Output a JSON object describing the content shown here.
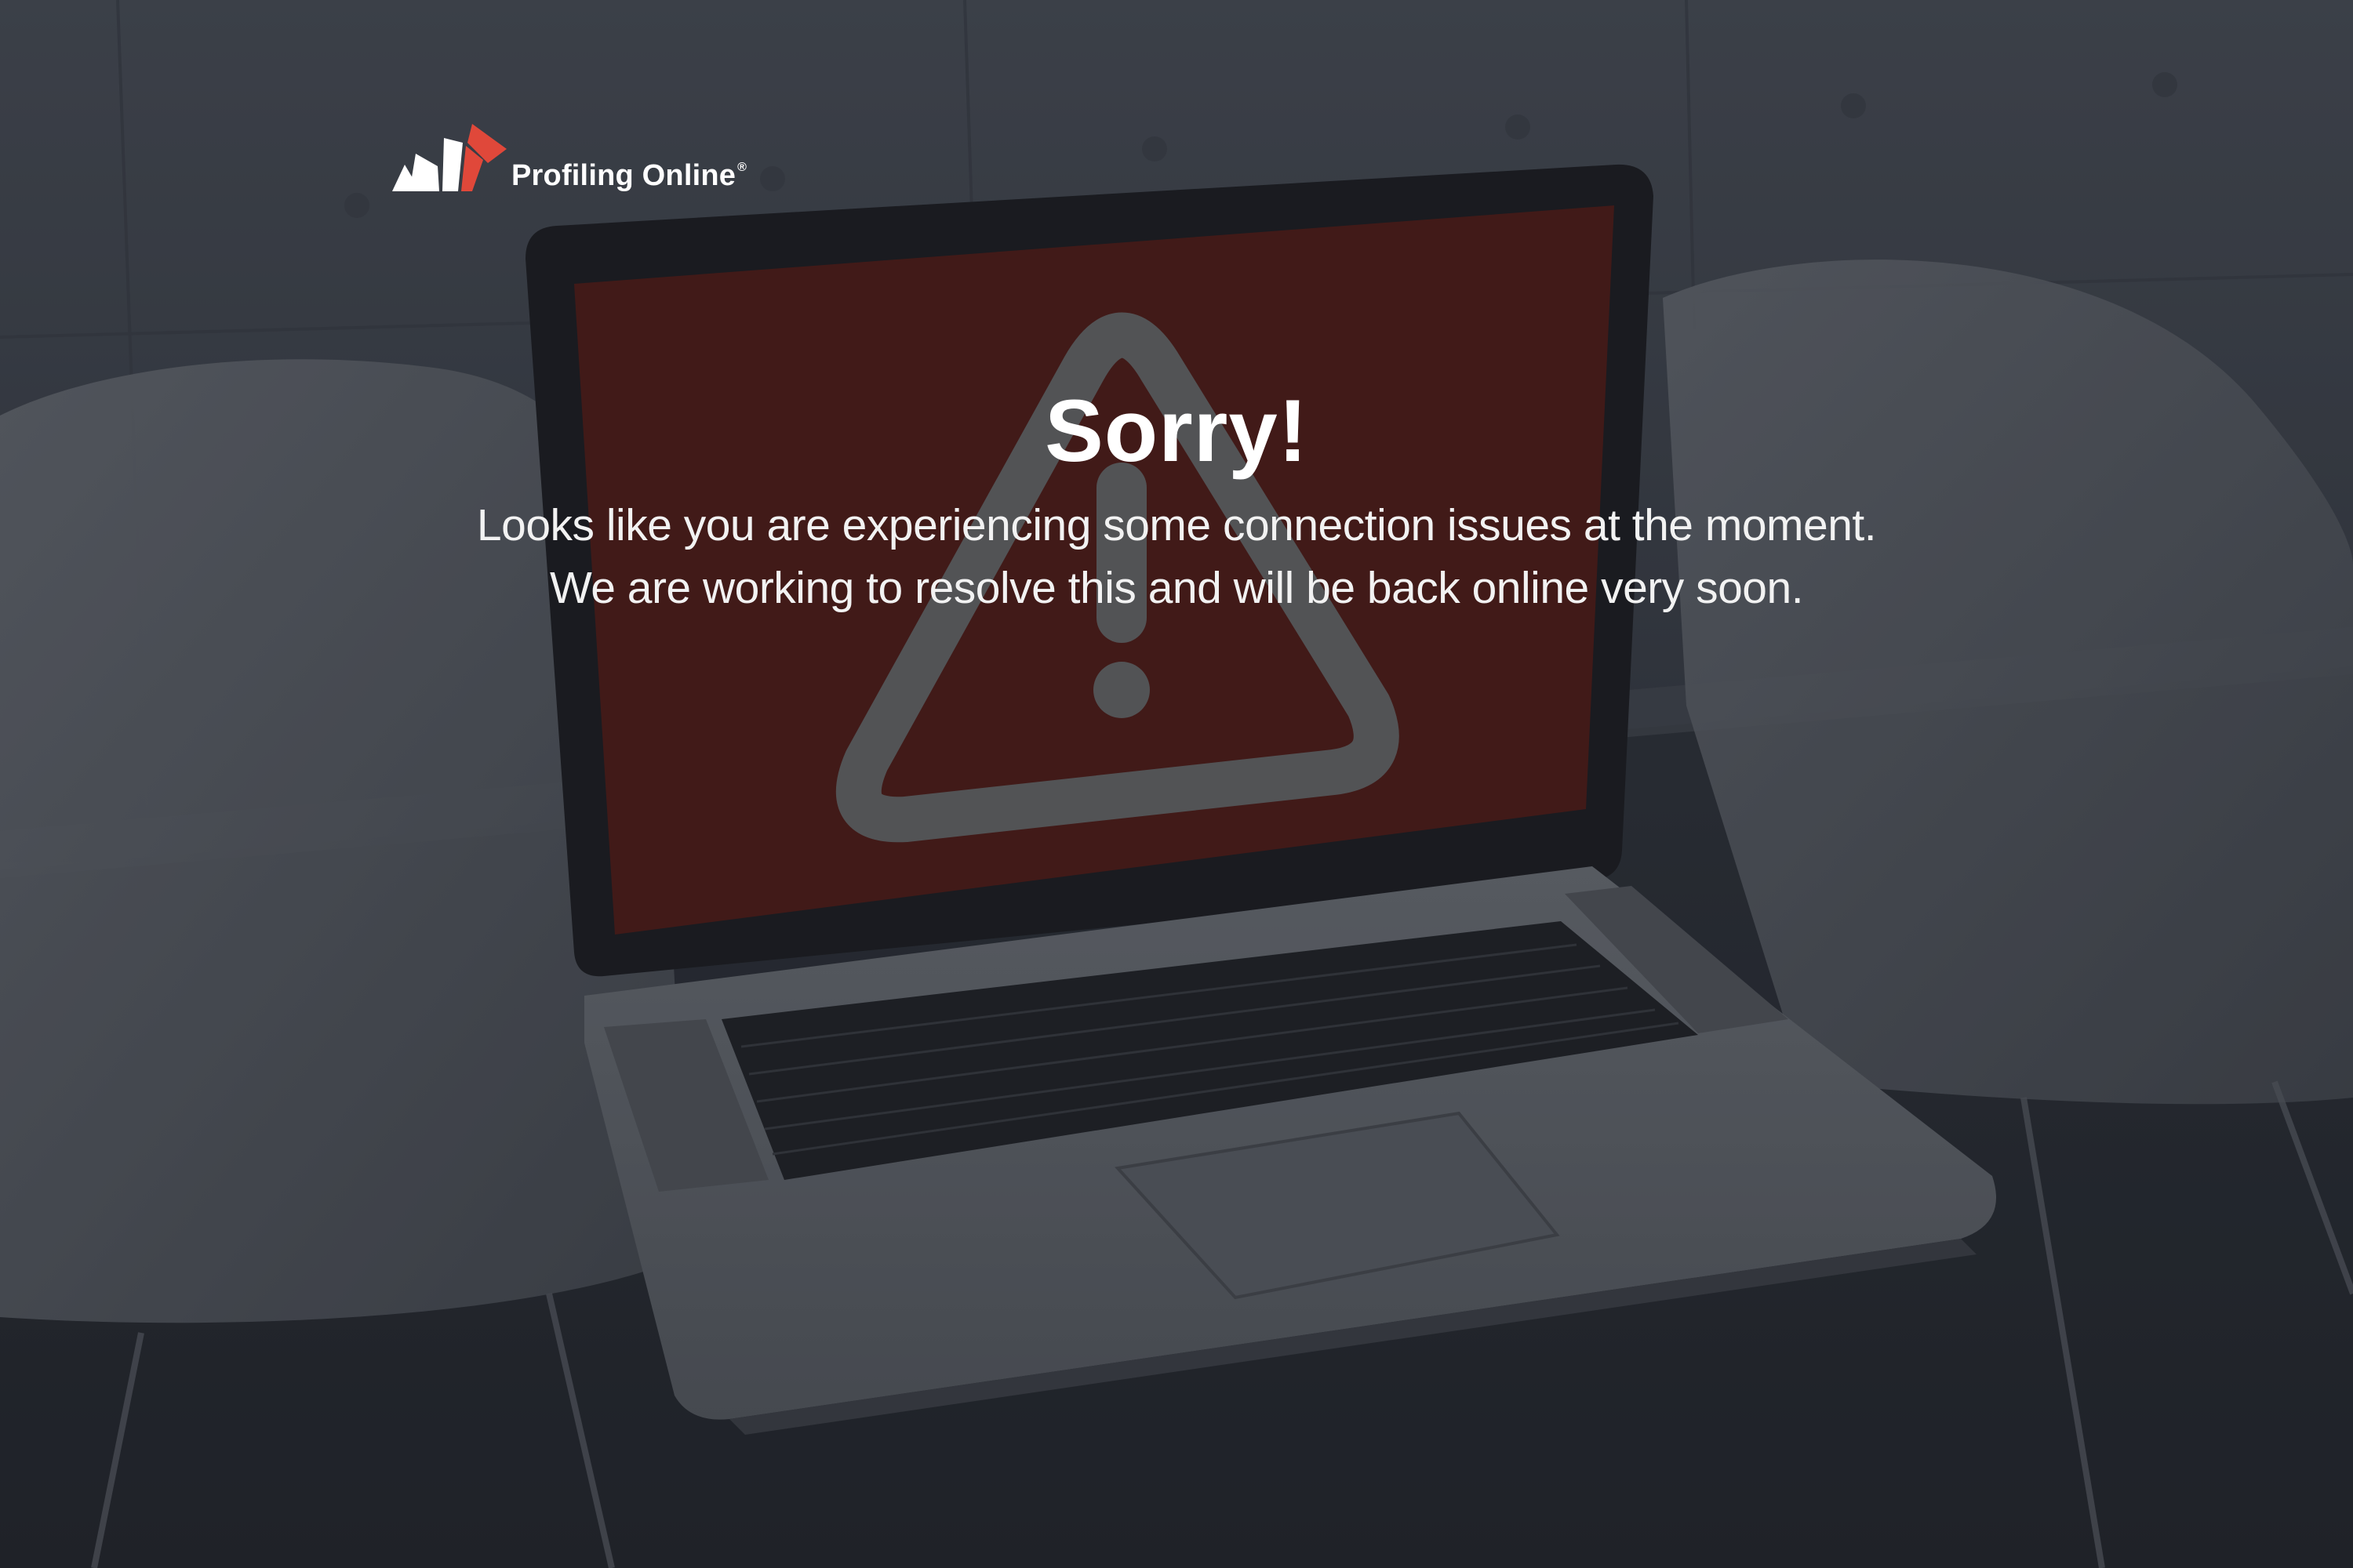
{
  "brand": {
    "name": "Profiling Online",
    "registered_mark": "®",
    "colors": {
      "accent_red": "#e0483a",
      "logo_white": "#ffffff"
    }
  },
  "message": {
    "title": "Sorry!",
    "line_1": "Looks like you are experiencing some connection issues at the moment.",
    "line_2": "We are working to resolve this and will be back online very soon."
  },
  "background": {
    "icon": "warning-triangle-icon",
    "screen_color": "#531b16",
    "overlay_color": "#161a21"
  }
}
